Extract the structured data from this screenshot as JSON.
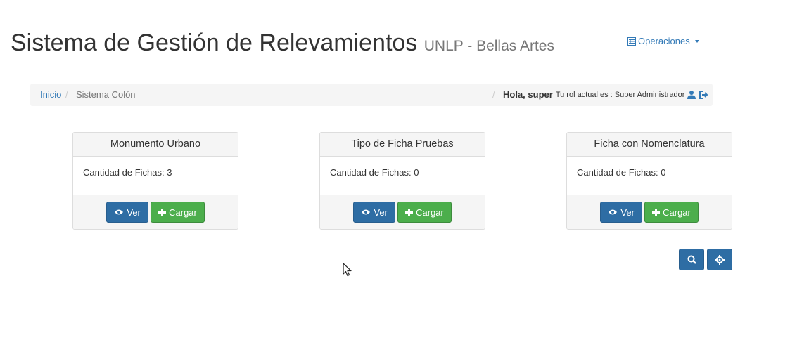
{
  "header": {
    "title": "Sistema de Gestión de Relevamientos",
    "subtitle": "UNLP - Bellas Artes",
    "operations_label": "Operaciones"
  },
  "breadcrumb": {
    "home": "Inicio",
    "separator": "/",
    "current": "Sistema Colón"
  },
  "user": {
    "greeting": "Hola, super",
    "role_text": "Tu rol actual es : Super Administrador"
  },
  "cards": [
    {
      "title": "Monumento Urbano",
      "count_text": "Cantidad de Fichas: 3",
      "view_label": "Ver",
      "load_label": "Cargar"
    },
    {
      "title": "Tipo de Ficha Pruebas",
      "count_text": "Cantidad de Fichas: 0",
      "view_label": "Ver",
      "load_label": "Cargar"
    },
    {
      "title": "Ficha con Nomenclatura",
      "count_text": "Cantidad de Fichas: 0",
      "view_label": "Ver",
      "load_label": "Cargar"
    }
  ],
  "icons": {
    "operations": "list-icon",
    "user": "user-icon",
    "logout": "logout-icon",
    "view": "eye-icon",
    "load": "plus-icon",
    "search": "search-icon",
    "locate": "crosshair-icon"
  },
  "colors": {
    "link": "#337ab7",
    "primary": "#2e6da4",
    "success": "#4cae4c",
    "panel_bg": "#f5f5f5"
  }
}
